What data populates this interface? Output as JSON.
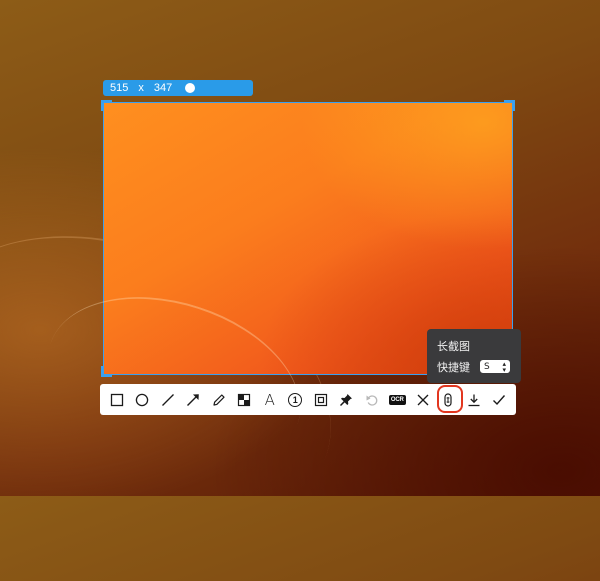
{
  "selection": {
    "width_label": "515",
    "separator": "x",
    "height_label": "347"
  },
  "tooltip": {
    "title": "长截图",
    "shortcut_label": "快捷键",
    "shortcut_key": "S",
    "shortcut_arrow": "⌃⌄"
  },
  "toolbar": {
    "tools": [
      {
        "name": "rectangle-tool",
        "icon": "rectangle-icon"
      },
      {
        "name": "ellipse-tool",
        "icon": "ellipse-icon"
      },
      {
        "name": "line-tool",
        "icon": "line-icon"
      },
      {
        "name": "arrow-tool",
        "icon": "arrow-icon"
      },
      {
        "name": "pen-tool",
        "icon": "pen-icon"
      },
      {
        "name": "mosaic-tool",
        "icon": "mosaic-icon"
      },
      {
        "name": "text-tool",
        "icon": "text-icon",
        "label": "A"
      },
      {
        "name": "number-marker-tool",
        "icon": "numbered-circle-icon",
        "label": "1"
      },
      {
        "name": "blur-frame-tool",
        "icon": "frame-icon"
      },
      {
        "name": "pin-tool",
        "icon": "pin-icon"
      },
      {
        "name": "undo-tool",
        "icon": "undo-icon"
      },
      {
        "name": "ocr-tool",
        "icon": "ocr-icon",
        "label": "OCR"
      },
      {
        "name": "close-tool",
        "icon": "close-icon"
      },
      {
        "name": "long-screenshot-tool",
        "icon": "long-screenshot-icon",
        "active": true
      },
      {
        "name": "download-tool",
        "icon": "download-icon"
      },
      {
        "name": "confirm-tool",
        "icon": "check-icon"
      }
    ]
  },
  "colors": {
    "accent": "#2a9be8",
    "highlight_ring": "#e2361f",
    "tooltip_bg": "#3a3a3c"
  }
}
